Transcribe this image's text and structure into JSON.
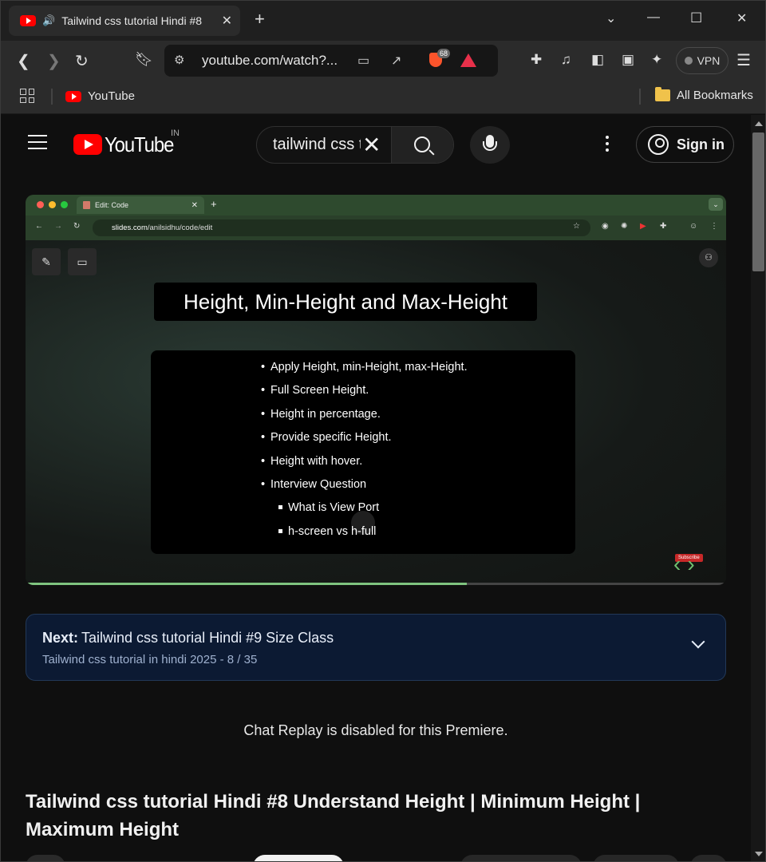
{
  "browser": {
    "tab_title": "Tailwind css tutorial Hindi #8",
    "url": "youtube.com/watch?...",
    "brave_badge": "68",
    "vpn_label": "VPN",
    "bookmarks": {
      "youtube": "YouTube",
      "all": "All Bookmarks"
    }
  },
  "youtube": {
    "logo_text": "YouTube",
    "country": "IN",
    "search_query": "tailwind css tutorial",
    "signin_label": "Sign in"
  },
  "video": {
    "inner_tab": "Edit: Code",
    "inner_url_host": "slides.com",
    "inner_url_path": "/anilsidhu/code/edit",
    "slide_title": "Height, Min-Height and Max-Height",
    "bullets": [
      "Apply Height, min-Height, max-Height.",
      "Full Screen Height.",
      "Height in percentage.",
      "Provide specific Height.",
      "Height with hover.",
      "Interview Question"
    ],
    "sub_bullets": [
      "What is View Port",
      "h-screen vs h-full"
    ],
    "subscribe_label": "Subscribe",
    "progress": 0.63
  },
  "playlist": {
    "next_label": "Next:",
    "next_title": "Tailwind css tutorial Hindi #9 Size Class",
    "playlist_info": "Tailwind css tutorial in hindi 2025 - 8 / 35"
  },
  "chat_message": "Chat Replay is disabled for this Premiere.",
  "video_title": "Tailwind css tutorial Hindi #8 Understand Height | Minimum Height | Maximum Height",
  "colors": {
    "brand_red": "#ff0000",
    "next_card_bg": "#0c1a33"
  }
}
